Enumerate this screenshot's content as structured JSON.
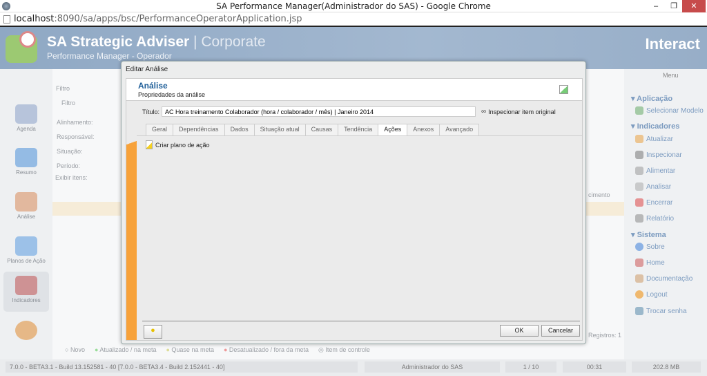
{
  "window": {
    "title": "SA Performance Manager(Administrador do SAS) - Google Chrome",
    "minimize": "–",
    "restore": "❐",
    "close": "✕"
  },
  "browser": {
    "url_host": "localhost",
    "url_path": ":8090/sa/apps/bsc/PerformanceOperatorApplication.jsp"
  },
  "header": {
    "app_name": "SA Strategic Adviser",
    "edition": "| Corporate",
    "subtitle": "Performance Manager - Operador",
    "logo": "Interact"
  },
  "leftbar": {
    "items": [
      {
        "label": "Agenda",
        "color": "#8aa0c8"
      },
      {
        "label": "Resumo",
        "color": "#4a90d9"
      },
      {
        "label": "Análise",
        "color": "#d98a5a"
      },
      {
        "label": "Planos de Ação",
        "color": "#5a9ae0"
      },
      {
        "label": "Indicadores",
        "color": "#c05050",
        "active": true
      },
      {
        "label": "",
        "color": "#e08a30"
      }
    ]
  },
  "background": {
    "filter_title": "Filtro",
    "filter_tab": "Filtro",
    "fields": [
      "Alinhamento:",
      "Responsável:",
      "Situação:",
      "Período:",
      "Exibir itens:"
    ],
    "column_fragment": "cimento",
    "records": "Registros: 1",
    "legend": [
      "Novo",
      "Atualizado / na meta",
      "Quase na meta",
      "Desatualizado / fora da meta",
      "Item de controle"
    ]
  },
  "rightbar": {
    "menu_label": "Menu",
    "sections": [
      {
        "title": "Aplicação",
        "items": [
          {
            "label": "Selecionar Modelo",
            "icon": "models-icon"
          }
        ]
      },
      {
        "title": "Indicadores",
        "items": [
          {
            "label": "Atualizar",
            "icon": "refresh-icon"
          },
          {
            "label": "Inspecionar",
            "icon": "glasses-icon"
          },
          {
            "label": "Alimentar",
            "icon": "feed-icon"
          },
          {
            "label": "Analisar",
            "icon": "analyze-icon"
          },
          {
            "label": "Encerrar",
            "icon": "briefcase-icon"
          },
          {
            "label": "Relatório",
            "icon": "report-icon"
          }
        ]
      },
      {
        "title": "Sistema",
        "items": [
          {
            "label": "Sobre",
            "icon": "info-icon"
          },
          {
            "label": "Home",
            "icon": "home-icon"
          },
          {
            "label": "Documentação",
            "icon": "docs-icon"
          },
          {
            "label": "Logout",
            "icon": "logout-icon"
          },
          {
            "label": "Trocar senha",
            "icon": "user-key-icon"
          }
        ]
      }
    ]
  },
  "status": {
    "version": "7.0.0 - BETA3.1 - Build 13.152581 - 40 [7.0.0 - BETA3.4 - Build 2.152441 - 40]",
    "user": "Administrador do SAS",
    "pages": "1 / 10",
    "time": "00:31",
    "memory": "202.8 MB"
  },
  "modal": {
    "title": "Editar Análise",
    "heading": "Análise",
    "subheading": "Propriedades da análise",
    "title_label": "Título:",
    "title_value": "AC Hora treinamento Colaborador (hora / colaborador / mês) | Janeiro 2014",
    "inspect_link": "Inspecionar item original",
    "tabs": [
      {
        "label": "Geral"
      },
      {
        "label": "Dependências"
      },
      {
        "label": "Dados"
      },
      {
        "label": "Situação atual"
      },
      {
        "label": "Causas"
      },
      {
        "label": "Tendência"
      },
      {
        "label": "Ações",
        "active": true
      },
      {
        "label": "Anexos"
      },
      {
        "label": "Avançado"
      }
    ],
    "create_action": "Criar plano de ação",
    "ok": "OK",
    "cancel": "Cancelar"
  },
  "colors": {
    "accent": "#1f5f99",
    "stripe": "#f7a23a",
    "header": "#7f9abb"
  }
}
